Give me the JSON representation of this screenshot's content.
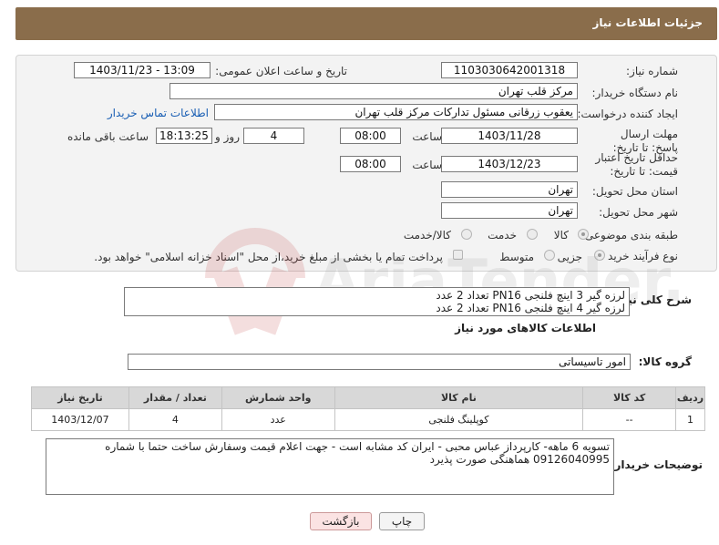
{
  "header": {
    "title": "جزئیات اطلاعات نیاز"
  },
  "form": {
    "need_number_label": "شماره نیاز:",
    "need_number": "1103030642001318",
    "announce_label": "تاریخ و ساعت اعلان عمومی:",
    "announce_value": "1403/11/23 - 13:09",
    "buyer_org_label": "نام دستگاه خریدار:",
    "buyer_org": "مرکز قلب تهران",
    "creator_label": "ایجاد کننده درخواست:",
    "creator": "یعقوب زرقانی مسئول تدارکات مرکز قلب تهران",
    "contact_link": "اطلاعات تماس خریدار",
    "deadline_label": "مهلت ارسال پاسخ: تا تاریخ:",
    "deadline_date": "1403/11/28",
    "time_label": "ساعت",
    "deadline_time": "08:00",
    "days_count": "4",
    "days_label": "روز و",
    "remaining_time": "18:13:25",
    "remaining_label": "ساعت باقی مانده",
    "validity_label": "حداقل تاریخ اعتبار قیمت: تا تاریخ:",
    "validity_date": "1403/12/23",
    "validity_time": "08:00",
    "province_label": "استان محل تحویل:",
    "province": "تهران",
    "city_label": "شهر محل تحویل:",
    "city": "تهران",
    "category_label": "طبقه بندی موضوعی:",
    "category_options": [
      "کالا",
      "خدمت",
      "کالا/خدمت"
    ],
    "process_label": "نوع فرآیند خرید :",
    "process_options": [
      "جزیی",
      "متوسط"
    ],
    "payment_note": "پرداخت تمام یا بخشی از مبلغ خرید،از محل \"اسناد خزانه اسلامی\" خواهد بود."
  },
  "description": {
    "label": "شرح کلی نیاز:",
    "line1": "لرزه گیر 3 اینچ فلنجی PN16 تعداد 2 عدد",
    "line2": "لرزه گیر 4 اینچ فلنجی PN16 تعداد 2 عدد"
  },
  "goods_info": {
    "title": "اطلاعات کالاهای مورد نیاز",
    "group_label": "گروه کالا:",
    "group_value": "امور تاسیساتی"
  },
  "table": {
    "headers": [
      "ردیف",
      "کد کالا",
      "نام کالا",
      "واحد شمارش",
      "تعداد / مقدار",
      "تاریخ نیاز"
    ],
    "rows": [
      {
        "row": "1",
        "code": "--",
        "name": "کوپلینگ فلنجی",
        "unit": "عدد",
        "qty": "4",
        "date": "1403/12/07"
      }
    ]
  },
  "buyer_notes": {
    "label": "توضیحات خریدار:",
    "line1": "تسویه 6 ماهه- کارپرداز عباس محبی - ایران کد مشابه است - جهت اعلام قیمت وسفارش ساخت حتما با شماره",
    "line2": "09126040995 هماهنگی صورت پذیرد"
  },
  "buttons": {
    "print": "چاپ",
    "back": "بازگشت"
  },
  "watermark_text": "AriaTender.net",
  "colors": {
    "header": "#8a6d4b",
    "link": "#1a5fb4",
    "back_button": "#fbe3e3"
  }
}
